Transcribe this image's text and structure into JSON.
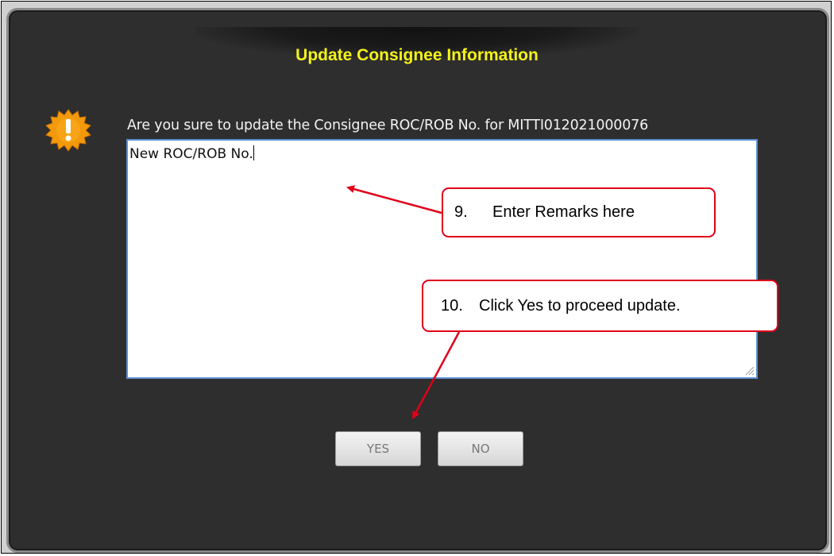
{
  "dialog": {
    "title": "Update Consignee Information",
    "message": "Are you sure to update the Consignee ROC/ROB No. for MITTI012021000076",
    "remarks": {
      "value": "New ROC/ROB No."
    },
    "buttons": {
      "yes_label": "YES",
      "no_label": "NO"
    }
  },
  "annotations": [
    {
      "number": "9.",
      "text": "Enter Remarks here"
    },
    {
      "number": "10.",
      "text": "Click Yes to proceed update."
    }
  ],
  "colors": {
    "dialog_background": "#2e2e2e",
    "title": "#f5f21a",
    "callout_border": "#e0001a",
    "warning_icon": "#f39a0c"
  },
  "icons": {
    "warning": "warning-burst-icon"
  }
}
